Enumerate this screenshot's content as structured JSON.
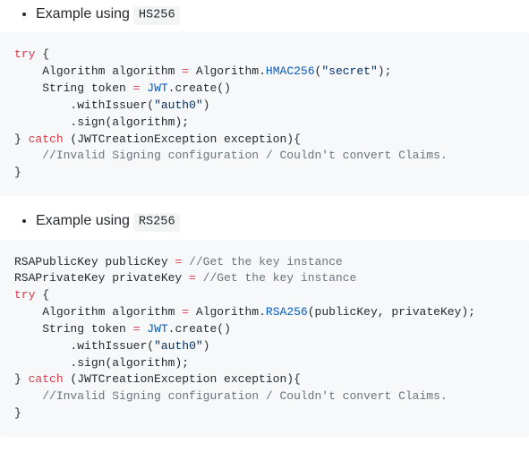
{
  "examples": [
    {
      "label_prefix": "Example using ",
      "algo_tag": "HS256",
      "code": {
        "l1": {
          "try": "try",
          "brace": " {"
        },
        "l2": {
          "indent": "    ",
          "type1": "Algorithm",
          "var": " algorithm ",
          "eq": "=",
          "sp": " ",
          "type2": "Algorithm",
          "dot": ".",
          "fn": "HMAC256",
          "open": "(",
          "str": "\"secret\"",
          "close": ");"
        },
        "l3": {
          "indent": "    ",
          "type": "String",
          "var": " token ",
          "eq": "=",
          "sp": " ",
          "cls": "JWT",
          "dot": ".",
          "m": "create()"
        },
        "l4": {
          "indent": "        ",
          "dot": ".",
          "m": "withIssuer(",
          "str": "\"auth0\"",
          "close": ")"
        },
        "l5": {
          "indent": "        ",
          "dot": ".",
          "m": "sign(algorithm);"
        },
        "l6": {
          "close": "} ",
          "catch": "catch",
          "rest": " (JWTCreationException exception){"
        },
        "l7": {
          "indent": "    ",
          "cmt": "//Invalid Signing configuration / Couldn't convert Claims."
        },
        "l8": {
          "close": "}"
        }
      }
    },
    {
      "label_prefix": "Example using ",
      "algo_tag": "RS256",
      "code": {
        "p1": {
          "type": "RSAPublicKey",
          "var": " publicKey ",
          "eq": "=",
          "sp": " ",
          "cmt": "//Get the key instance"
        },
        "p2": {
          "type": "RSAPrivateKey",
          "var": " privateKey ",
          "eq": "=",
          "sp": " ",
          "cmt": "//Get the key instance"
        },
        "l1": {
          "try": "try",
          "brace": " {"
        },
        "l2": {
          "indent": "    ",
          "type1": "Algorithm",
          "var": " algorithm ",
          "eq": "=",
          "sp": " ",
          "type2": "Algorithm",
          "dot": ".",
          "fn": "RSA256",
          "open": "(publicKey, privateKey);"
        },
        "l3": {
          "indent": "    ",
          "type": "String",
          "var": " token ",
          "eq": "=",
          "sp": " ",
          "cls": "JWT",
          "dot": ".",
          "m": "create()"
        },
        "l4": {
          "indent": "        ",
          "dot": ".",
          "m": "withIssuer(",
          "str": "\"auth0\"",
          "close": ")"
        },
        "l5": {
          "indent": "        ",
          "dot": ".",
          "m": "sign(algorithm);"
        },
        "l6": {
          "close": "} ",
          "catch": "catch",
          "rest": " (JWTCreationException exception){"
        },
        "l7": {
          "indent": "    ",
          "cmt": "//Invalid Signing configuration / Couldn't convert Claims."
        },
        "l8": {
          "close": "}"
        }
      }
    }
  ]
}
